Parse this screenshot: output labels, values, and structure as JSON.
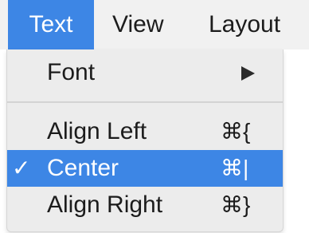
{
  "menubar": {
    "items": [
      {
        "label": "Text",
        "active": true
      },
      {
        "label": "View",
        "active": false
      },
      {
        "label": "Layout",
        "active": false
      }
    ]
  },
  "dropdown": {
    "font": {
      "label": "Font",
      "has_submenu": true
    },
    "items": [
      {
        "label": "Align Left",
        "shortcut": "⌘{",
        "checked": false,
        "highlighted": false
      },
      {
        "label": "Center",
        "shortcut": "⌘|",
        "checked": true,
        "highlighted": true
      },
      {
        "label": "Align Right",
        "shortcut": "⌘}",
        "checked": false,
        "highlighted": false
      }
    ],
    "checkmark": "✓"
  },
  "colors": {
    "highlight": "#3d86e5",
    "menubar_bg": "#f1f1f1",
    "menu_bg": "#ececec",
    "text": "#1c1c1c"
  }
}
